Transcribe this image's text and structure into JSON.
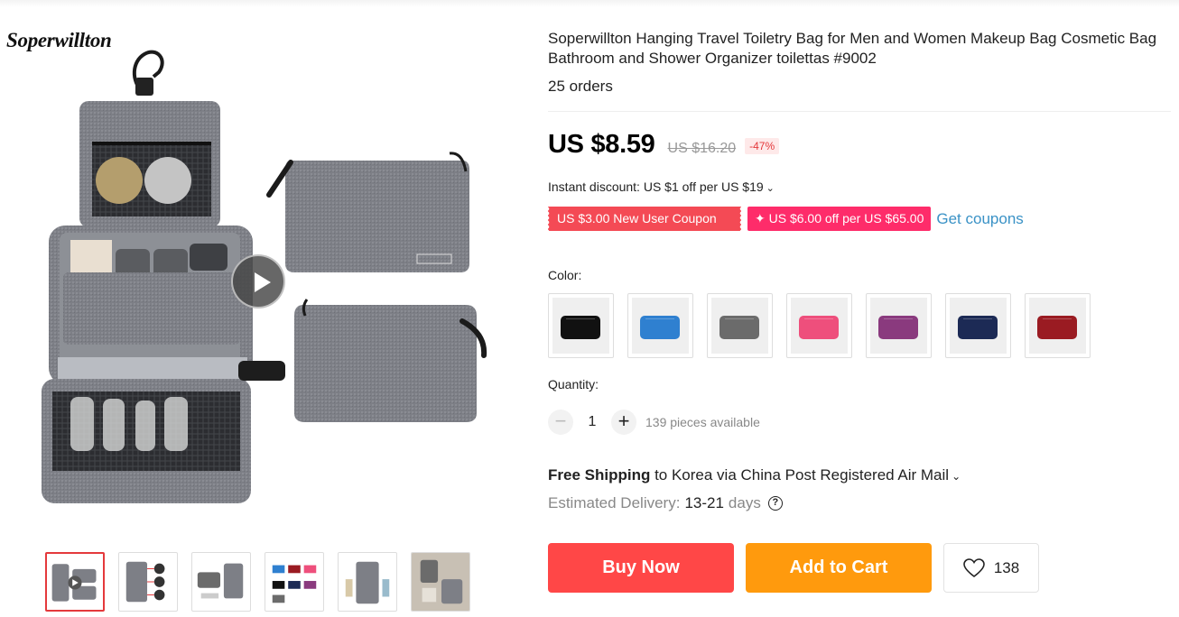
{
  "brand": {
    "logo_text": "Soperwillton"
  },
  "product": {
    "title": "Soperwillton Hanging Travel Toiletry Bag for Men and Women Makeup Bag Cosmetic Bag Bathroom and Shower Organizer toilettas #9002",
    "orders": "25 orders"
  },
  "price": {
    "current": "US $8.59",
    "original": "US $16.20",
    "discount": "-47%"
  },
  "promo": {
    "instant_discount": "Instant discount: US $1 off per US $19",
    "coupon_new_user": "US $3.00 New User Coupon",
    "coupon_store": "✦ US $6.00 off per US $65.00",
    "get_coupons": "Get coupons"
  },
  "color": {
    "label": "Color:",
    "options": [
      "#111111",
      "#2f80d0",
      "#6b6b6b",
      "#ee4f7c",
      "#8a3a7e",
      "#1c2a55",
      "#9a1b22"
    ]
  },
  "quantity": {
    "label": "Quantity:",
    "minus": "−",
    "value": "1",
    "plus": "+",
    "available": "139 pieces available"
  },
  "shipping": {
    "free_label": "Free Shipping",
    "route": " to Korea via China Post Registered Air Mail",
    "estimated_label": "Estimated Delivery:",
    "days_value": "13-21",
    "days_unit": "days",
    "help_icon": "?"
  },
  "actions": {
    "buy_now": "Buy Now",
    "add_to_cart": "Add to Cart",
    "wishlist_count": "138"
  },
  "theme": {
    "buy_color": "#ff4747",
    "cart_color": "#ff9a0d",
    "coupon_red": "#f44a55",
    "coupon_pink": "#fe2c6a",
    "link_blue": "#3a92c6"
  }
}
